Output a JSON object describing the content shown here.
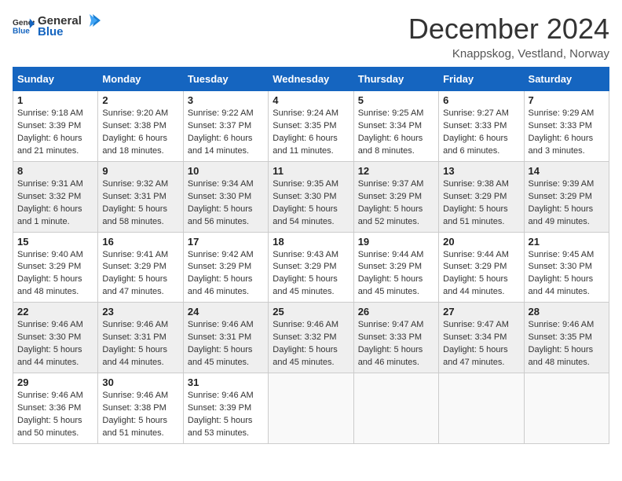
{
  "logo": {
    "general": "General",
    "blue": "Blue"
  },
  "title": "December 2024",
  "location": "Knappskog, Vestland, Norway",
  "days": [
    "Sunday",
    "Monday",
    "Tuesday",
    "Wednesday",
    "Thursday",
    "Friday",
    "Saturday"
  ],
  "weeks": [
    [
      {
        "day": 1,
        "sunrise": "9:18 AM",
        "sunset": "3:39 PM",
        "daylight": "6 hours and 21 minutes."
      },
      {
        "day": 2,
        "sunrise": "9:20 AM",
        "sunset": "3:38 PM",
        "daylight": "6 hours and 18 minutes."
      },
      {
        "day": 3,
        "sunrise": "9:22 AM",
        "sunset": "3:37 PM",
        "daylight": "6 hours and 14 minutes."
      },
      {
        "day": 4,
        "sunrise": "9:24 AM",
        "sunset": "3:35 PM",
        "daylight": "6 hours and 11 minutes."
      },
      {
        "day": 5,
        "sunrise": "9:25 AM",
        "sunset": "3:34 PM",
        "daylight": "6 hours and 8 minutes."
      },
      {
        "day": 6,
        "sunrise": "9:27 AM",
        "sunset": "3:33 PM",
        "daylight": "6 hours and 6 minutes."
      },
      {
        "day": 7,
        "sunrise": "9:29 AM",
        "sunset": "3:33 PM",
        "daylight": "6 hours and 3 minutes."
      }
    ],
    [
      {
        "day": 8,
        "sunrise": "9:31 AM",
        "sunset": "3:32 PM",
        "daylight": "6 hours and 1 minute."
      },
      {
        "day": 9,
        "sunrise": "9:32 AM",
        "sunset": "3:31 PM",
        "daylight": "5 hours and 58 minutes."
      },
      {
        "day": 10,
        "sunrise": "9:34 AM",
        "sunset": "3:30 PM",
        "daylight": "5 hours and 56 minutes."
      },
      {
        "day": 11,
        "sunrise": "9:35 AM",
        "sunset": "3:30 PM",
        "daylight": "5 hours and 54 minutes."
      },
      {
        "day": 12,
        "sunrise": "9:37 AM",
        "sunset": "3:29 PM",
        "daylight": "5 hours and 52 minutes."
      },
      {
        "day": 13,
        "sunrise": "9:38 AM",
        "sunset": "3:29 PM",
        "daylight": "5 hours and 51 minutes."
      },
      {
        "day": 14,
        "sunrise": "9:39 AM",
        "sunset": "3:29 PM",
        "daylight": "5 hours and 49 minutes."
      }
    ],
    [
      {
        "day": 15,
        "sunrise": "9:40 AM",
        "sunset": "3:29 PM",
        "daylight": "5 hours and 48 minutes."
      },
      {
        "day": 16,
        "sunrise": "9:41 AM",
        "sunset": "3:29 PM",
        "daylight": "5 hours and 47 minutes."
      },
      {
        "day": 17,
        "sunrise": "9:42 AM",
        "sunset": "3:29 PM",
        "daylight": "5 hours and 46 minutes."
      },
      {
        "day": 18,
        "sunrise": "9:43 AM",
        "sunset": "3:29 PM",
        "daylight": "5 hours and 45 minutes."
      },
      {
        "day": 19,
        "sunrise": "9:44 AM",
        "sunset": "3:29 PM",
        "daylight": "5 hours and 45 minutes."
      },
      {
        "day": 20,
        "sunrise": "9:44 AM",
        "sunset": "3:29 PM",
        "daylight": "5 hours and 44 minutes."
      },
      {
        "day": 21,
        "sunrise": "9:45 AM",
        "sunset": "3:30 PM",
        "daylight": "5 hours and 44 minutes."
      }
    ],
    [
      {
        "day": 22,
        "sunrise": "9:46 AM",
        "sunset": "3:30 PM",
        "daylight": "5 hours and 44 minutes."
      },
      {
        "day": 23,
        "sunrise": "9:46 AM",
        "sunset": "3:31 PM",
        "daylight": "5 hours and 44 minutes."
      },
      {
        "day": 24,
        "sunrise": "9:46 AM",
        "sunset": "3:31 PM",
        "daylight": "5 hours and 45 minutes."
      },
      {
        "day": 25,
        "sunrise": "9:46 AM",
        "sunset": "3:32 PM",
        "daylight": "5 hours and 45 minutes."
      },
      {
        "day": 26,
        "sunrise": "9:47 AM",
        "sunset": "3:33 PM",
        "daylight": "5 hours and 46 minutes."
      },
      {
        "day": 27,
        "sunrise": "9:47 AM",
        "sunset": "3:34 PM",
        "daylight": "5 hours and 47 minutes."
      },
      {
        "day": 28,
        "sunrise": "9:46 AM",
        "sunset": "3:35 PM",
        "daylight": "5 hours and 48 minutes."
      }
    ],
    [
      {
        "day": 29,
        "sunrise": "9:46 AM",
        "sunset": "3:36 PM",
        "daylight": "5 hours and 50 minutes."
      },
      {
        "day": 30,
        "sunrise": "9:46 AM",
        "sunset": "3:38 PM",
        "daylight": "5 hours and 51 minutes."
      },
      {
        "day": 31,
        "sunrise": "9:46 AM",
        "sunset": "3:39 PM",
        "daylight": "5 hours and 53 minutes."
      },
      null,
      null,
      null,
      null
    ]
  ]
}
